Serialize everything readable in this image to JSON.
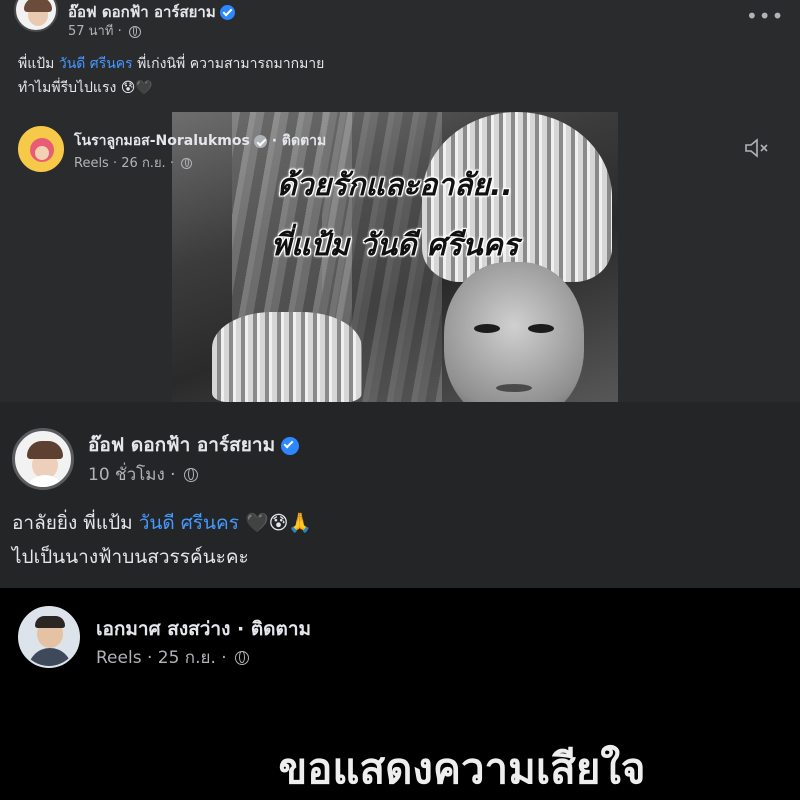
{
  "post1": {
    "author": "อ๊อฟ ดอกฟ้า อาร์สยาม",
    "time": "57 นาที",
    "more_label": "•••",
    "text_line1_prefix": "พี่แป้ม ",
    "text_line1_link": "วันดี ศรีนคร",
    "text_line1_suffix": " พี่เก่งนิพี่ ความสามารถมากมาย",
    "text_line2": "ทำไมพี่รีบไปแรง",
    "emoji": "😰",
    "heart": "🖤"
  },
  "reel1": {
    "author": "โนราลูกมอส-Noralukmos",
    "follow": "ติดตาม",
    "separator": "·",
    "label": "Reels",
    "date": "26 ก.ย.",
    "overlay_line1": "ด้วยรักและอาลัย..",
    "overlay_line2": "พี่แป้ม วันดี ศรีนคร",
    "mute_icon": "speaker-mute-icon"
  },
  "post2": {
    "author": "อ๊อฟ ดอกฟ้า อาร์สยาม",
    "time": "10 ชั่วโมง",
    "text_line1_prefix": "อาลัยยิ่ง พี่แป้ม ",
    "text_line1_link": "วันดี ศรีนคร",
    "text_line1_emojis": "🖤😰🙏",
    "text_line2": "ไปเป็นนางฟ้าบนสวรรค์นะคะ"
  },
  "reel2": {
    "author": "เอกมาศ สงสว่าง",
    "follow": "ติดตาม",
    "separator": "·",
    "label": "Reels",
    "date": "25 ก.ย.",
    "caption": "ขอแสดงความเสียใจ"
  },
  "colors": {
    "link": "#4599ff",
    "verified": "#2d88ff",
    "panel_dark": "#242526",
    "panel_mid": "#2a2b2d"
  }
}
